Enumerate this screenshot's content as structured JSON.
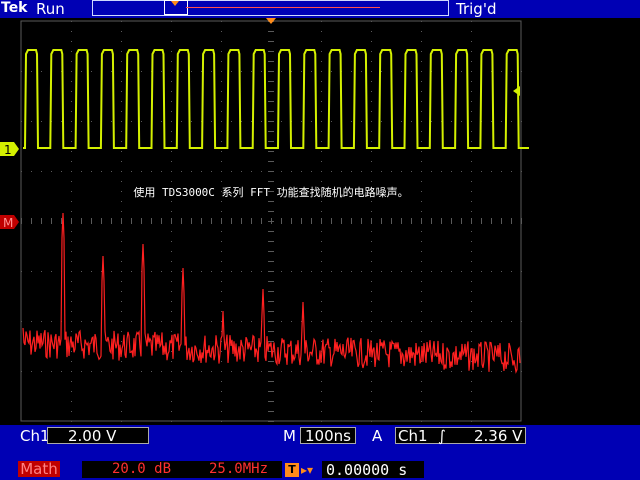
{
  "header": {
    "brand": "Tek",
    "run_state": "Run",
    "trigger_status": "Trig'd"
  },
  "screen": {
    "annotation": "使用 TDS3000C 系列 FFT 功能查找随机的电路噪声。",
    "ch1_marker": "1",
    "math_marker": "M"
  },
  "status": {
    "ch1_label": "Ch1",
    "ch1_scale": "2.00 V",
    "timebase_prefix": "M",
    "timebase": "100ns",
    "trigger_prefix": "A",
    "trigger_source": "Ch1",
    "trigger_slope_glyph": "∫",
    "trigger_level": "2.36 V",
    "math_label": "Math",
    "math_scale": "20.0 dB",
    "math_span": "25.0MHz",
    "position_icon": "T",
    "position_arrow": "▸▾",
    "position_value": "0.00000 s"
  },
  "colors": {
    "ch1_trace": "#d4f000",
    "math_trace": "#ff2020",
    "bar_bg": "#0000b4",
    "graticule": "#5a5a5a",
    "trigger_marker": "#ff8c1a"
  }
}
